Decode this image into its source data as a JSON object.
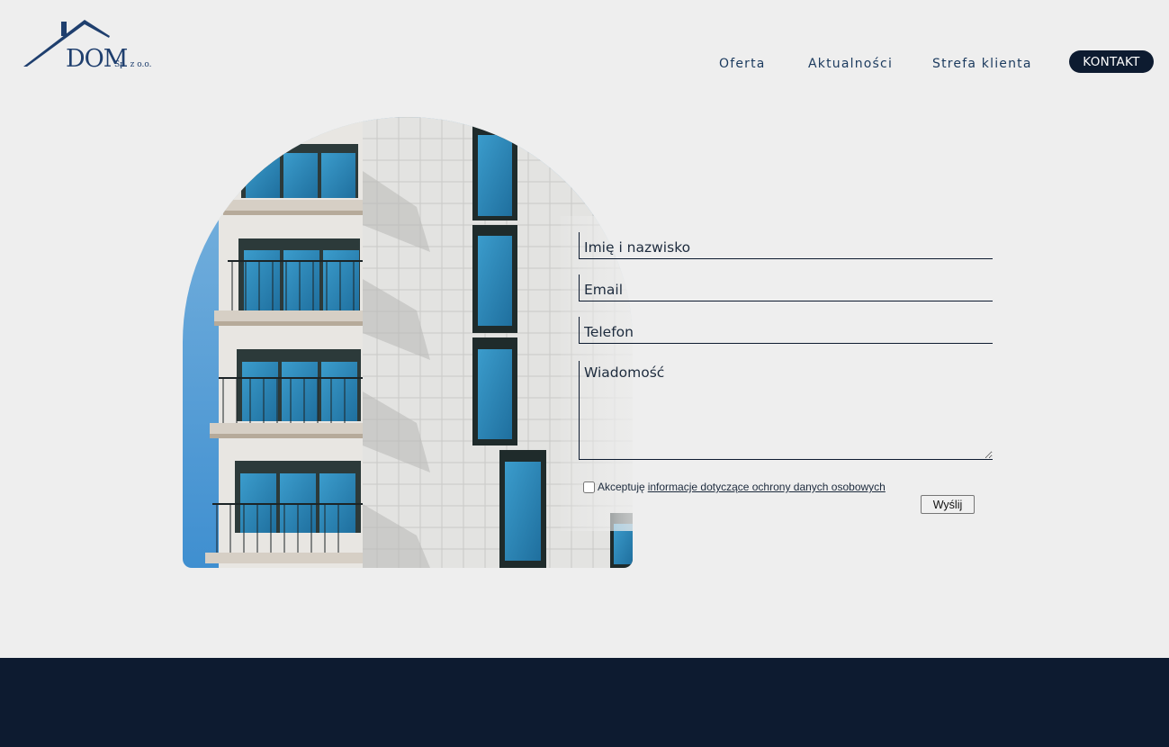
{
  "brand": {
    "name": "DOM",
    "suffix": "Sp. z o.o."
  },
  "nav": {
    "items": [
      "Oferta",
      "Aktualności",
      "Strefa klienta"
    ],
    "contact_label": "KONTAKT"
  },
  "form": {
    "name_placeholder": "Imię i nazwisko",
    "email_placeholder": "Email",
    "phone_placeholder": "Telefon",
    "message_placeholder": "Wiadomość",
    "consent_text": "Akceptuję",
    "consent_link": "informacje dotyczące ochrony danych osobowych",
    "submit_label": "Wyślij"
  },
  "colors": {
    "navy": "#0d1b30",
    "background": "#eeeeee",
    "nav_text": "#1b3a5e"
  }
}
